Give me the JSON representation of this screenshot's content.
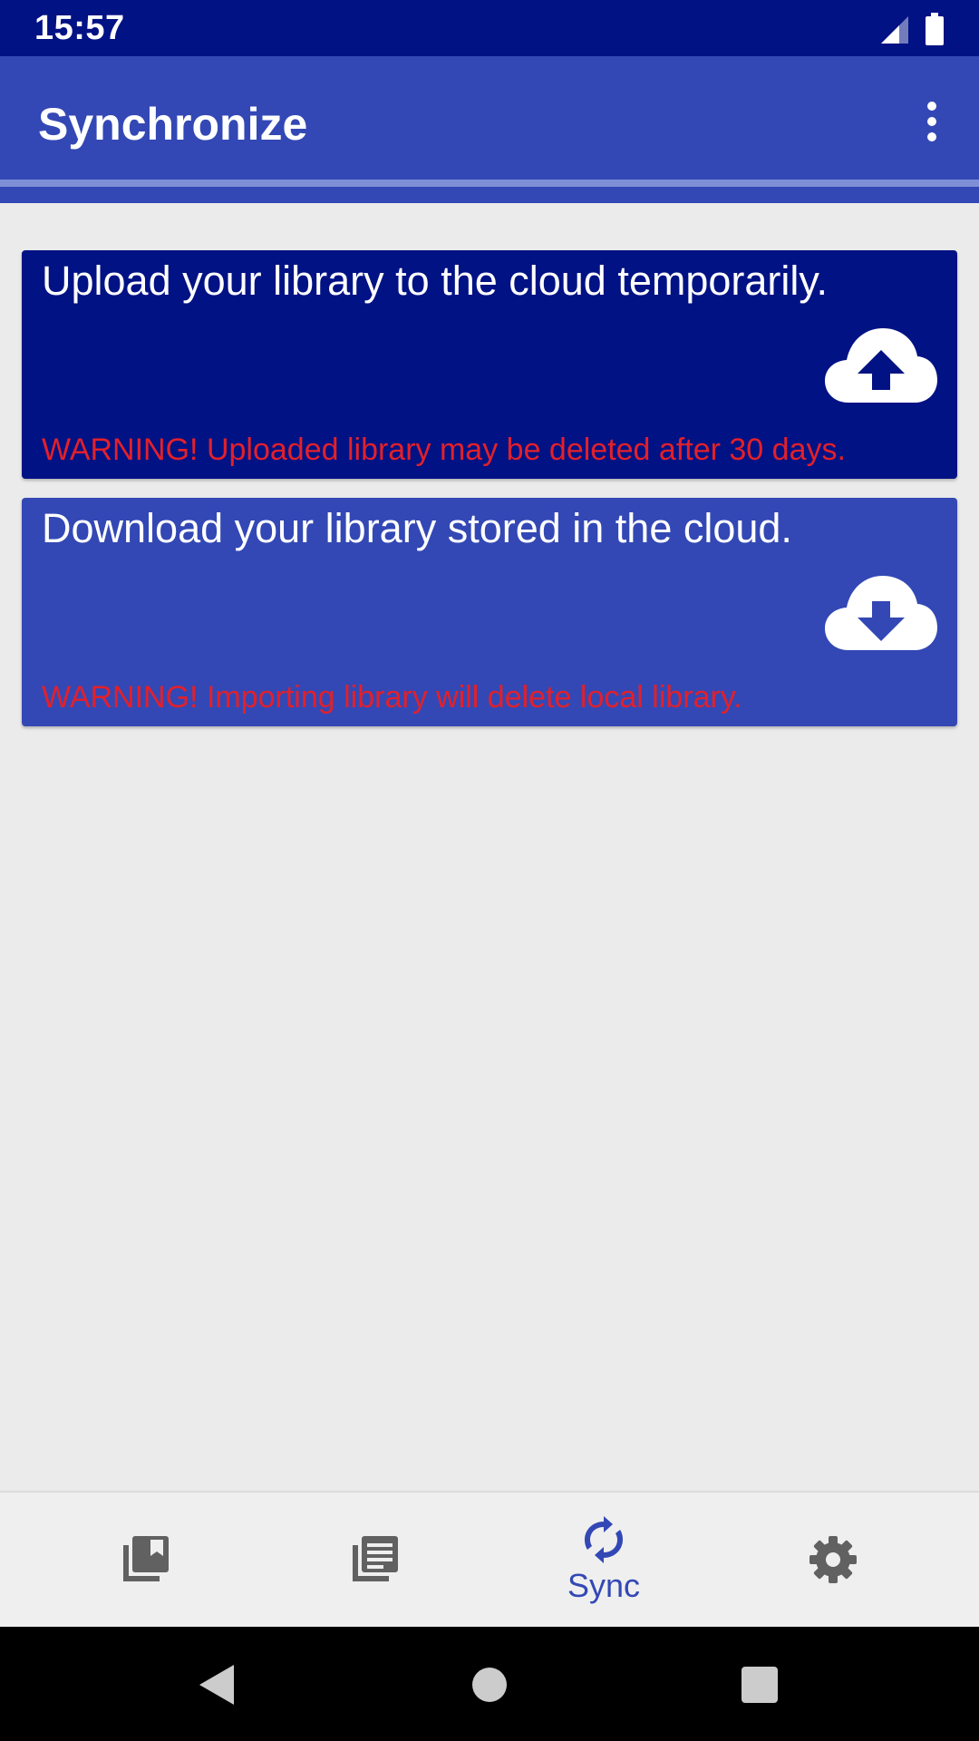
{
  "status_bar": {
    "time": "15:57",
    "icons": [
      "signal-icon",
      "battery-icon"
    ]
  },
  "app_bar": {
    "title": "Synchronize",
    "menu_icon": "more-vert-icon"
  },
  "cards": [
    {
      "title": "Upload your library to the cloud temporarily.",
      "warning": "WARNING! Uploaded library may be deleted after 30 days.",
      "icon": "cloud-upload-icon"
    },
    {
      "title": "Download your library stored in the cloud.",
      "warning": "WARNING! Importing library will delete local library.",
      "icon": "cloud-download-icon"
    }
  ],
  "bottom_nav": {
    "items": [
      {
        "icon": "library-books-icon",
        "label": ""
      },
      {
        "icon": "article-list-icon",
        "label": ""
      },
      {
        "icon": "sync-icon",
        "label": "Sync",
        "selected": true
      },
      {
        "icon": "settings-gear-icon",
        "label": ""
      }
    ]
  },
  "system_nav": [
    "back-icon",
    "home-icon",
    "recents-icon"
  ],
  "colors": {
    "status_bar": "#011284",
    "primary": "#3348b5",
    "upload_card": "#011284",
    "download_card": "#3348b5",
    "warning_text": "#e3202a",
    "background": "#ebebeb",
    "nav_icon_inactive": "#616161"
  }
}
